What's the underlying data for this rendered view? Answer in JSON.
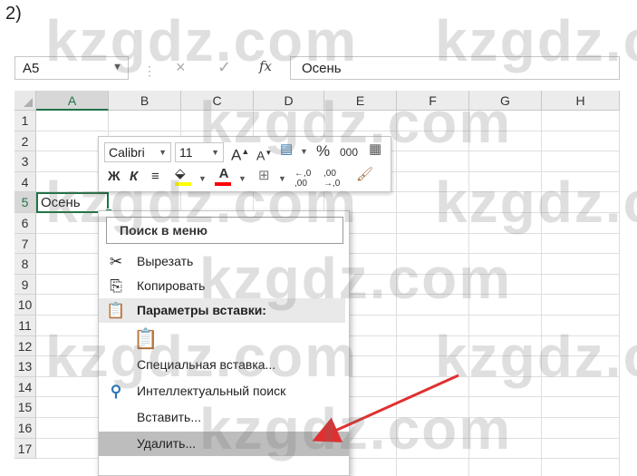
{
  "step_label": "2)",
  "formula_bar": {
    "name_box": "A5",
    "cancel_icon": "×",
    "enter_icon": "✓",
    "fx_label": "fx",
    "formula_value": "Осень"
  },
  "columns": [
    "A",
    "B",
    "C",
    "D",
    "E",
    "F",
    "G",
    "H"
  ],
  "rows": [
    "1",
    "2",
    "3",
    "4",
    "5",
    "6",
    "7",
    "8",
    "9",
    "10",
    "11",
    "12",
    "13",
    "14",
    "15",
    "16",
    "17"
  ],
  "active_cell": {
    "ref": "A5",
    "value": "Осень"
  },
  "mini_toolbar": {
    "font_name": "Calibri",
    "font_size": "11",
    "grow_font": "A",
    "shrink_font": "A",
    "percent": "%",
    "thousands": "000",
    "bold": "Ж",
    "italic": "К",
    "font_color_letter": "A",
    "increase_decimal": "←,0 ,00",
    "decrease_decimal": ",00 →,0",
    "fill_color": "#ffff00",
    "font_color": "#ff0000"
  },
  "context_menu": {
    "search_placeholder": "Поиск в меню",
    "cut": "Вырезать",
    "copy": "Копировать",
    "paste_options_header": "Параметры вставки:",
    "paste_special": "Специальная вставка...",
    "smart_lookup": "Интеллектуальный поиск",
    "insert": "Вставить...",
    "delete": "Удалить..."
  },
  "watermark": "kzgdz.com",
  "colors": {
    "excel_green": "#217346",
    "arrow": "#e03030"
  }
}
